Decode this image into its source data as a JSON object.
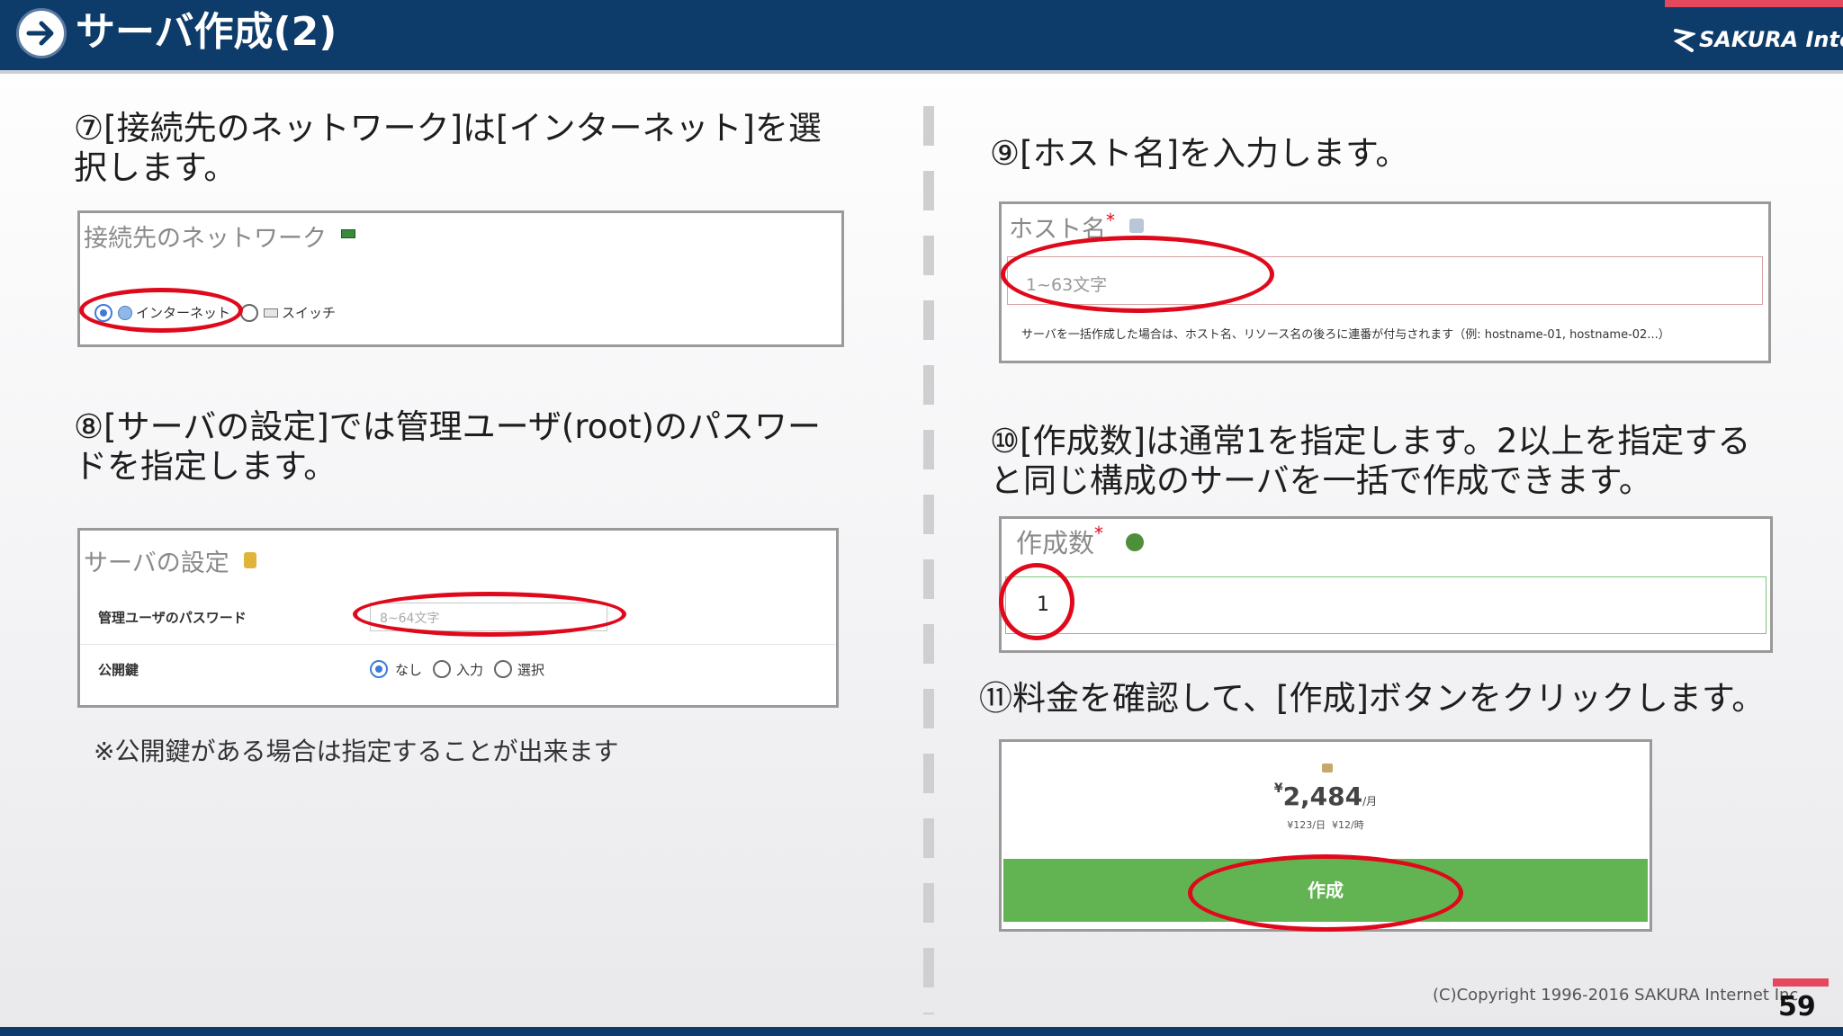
{
  "header": {
    "title": "サーバ作成(2)",
    "logo_text": "SAKURA Internet"
  },
  "left": {
    "step7": {
      "line1": "⑦[接続先のネットワーク]は[インターネット]を選",
      "line2": "択します。"
    },
    "network_panel": {
      "title": "接続先のネットワーク",
      "options": [
        "インターネット",
        "スイッチ"
      ],
      "selected": "インターネット"
    },
    "step8": {
      "line1": "⑧[サーバの設定]では管理ユーザ(root)のパスワー",
      "line2": "ドを指定します。"
    },
    "server_panel": {
      "title": "サーバの設定",
      "password_label": "管理ユーザのパスワード",
      "password_placeholder": "8~64文字",
      "pubkey_label": "公開鍵",
      "pubkey_options": [
        "なし",
        "入力",
        "選択"
      ],
      "pubkey_selected": "なし"
    },
    "note": "※公開鍵がある場合は指定することが出来ます"
  },
  "right": {
    "step9": {
      "line1": "⑨[ホスト名]を入力します。"
    },
    "host_panel": {
      "title": "ホスト名",
      "required_mark": "*",
      "placeholder": "1~63文字",
      "help": "サーバを一括作成した場合は、ホスト名、リソース名の後ろに連番が付与されます（例: hostname-01, hostname-02...）"
    },
    "step10": {
      "line1": "⑩[作成数]は通常1を指定します。2以上を指定する",
      "line2": "と同じ構成のサーバを一括で作成できます。"
    },
    "count_panel": {
      "title": "作成数",
      "required_mark": "*",
      "value": "1"
    },
    "step11": {
      "line1": "⑪料金を確認して、[作成]ボタンをクリックします。"
    },
    "price_panel": {
      "price_prefix": "¥",
      "price": "2,484",
      "price_unit": "/月",
      "sub_price_daily": "¥123/日",
      "sub_price_hourly": "¥12/時",
      "button_label": "作成"
    }
  },
  "footer": {
    "copyright": "(C)Copyright 1996-2016 SAKURA Internet Inc.",
    "page": "59"
  },
  "colors": {
    "header_bg": "#0d3b6a",
    "accent_pink": "#e5485d",
    "ring_red": "#e0091c",
    "button_green": "#62b452",
    "radio_blue": "#3f7cd6"
  }
}
